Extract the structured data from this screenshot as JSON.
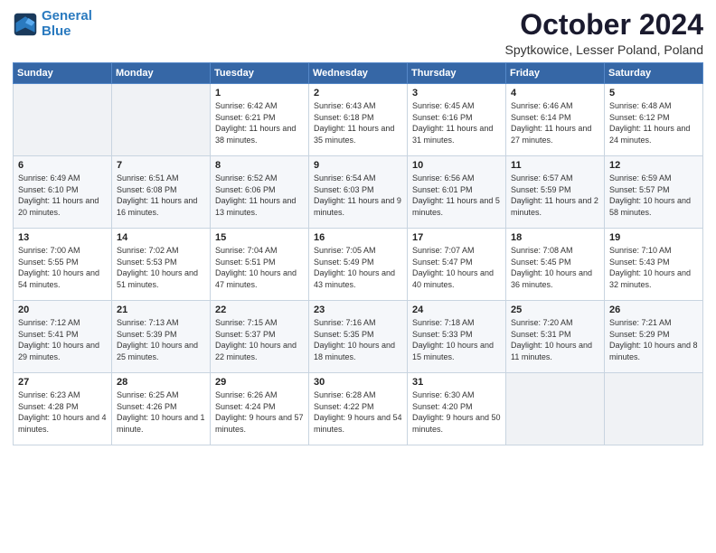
{
  "logo": {
    "line1": "General",
    "line2": "Blue"
  },
  "title": "October 2024",
  "subtitle": "Spytkowice, Lesser Poland, Poland",
  "headers": [
    "Sunday",
    "Monday",
    "Tuesday",
    "Wednesday",
    "Thursday",
    "Friday",
    "Saturday"
  ],
  "weeks": [
    [
      {
        "day": "",
        "sunrise": "",
        "sunset": "",
        "daylight": "",
        "empty": true
      },
      {
        "day": "",
        "sunrise": "",
        "sunset": "",
        "daylight": "",
        "empty": true
      },
      {
        "day": "1",
        "sunrise": "Sunrise: 6:42 AM",
        "sunset": "Sunset: 6:21 PM",
        "daylight": "Daylight: 11 hours and 38 minutes.",
        "empty": false
      },
      {
        "day": "2",
        "sunrise": "Sunrise: 6:43 AM",
        "sunset": "Sunset: 6:18 PM",
        "daylight": "Daylight: 11 hours and 35 minutes.",
        "empty": false
      },
      {
        "day": "3",
        "sunrise": "Sunrise: 6:45 AM",
        "sunset": "Sunset: 6:16 PM",
        "daylight": "Daylight: 11 hours and 31 minutes.",
        "empty": false
      },
      {
        "day": "4",
        "sunrise": "Sunrise: 6:46 AM",
        "sunset": "Sunset: 6:14 PM",
        "daylight": "Daylight: 11 hours and 27 minutes.",
        "empty": false
      },
      {
        "day": "5",
        "sunrise": "Sunrise: 6:48 AM",
        "sunset": "Sunset: 6:12 PM",
        "daylight": "Daylight: 11 hours and 24 minutes.",
        "empty": false
      }
    ],
    [
      {
        "day": "6",
        "sunrise": "Sunrise: 6:49 AM",
        "sunset": "Sunset: 6:10 PM",
        "daylight": "Daylight: 11 hours and 20 minutes.",
        "empty": false
      },
      {
        "day": "7",
        "sunrise": "Sunrise: 6:51 AM",
        "sunset": "Sunset: 6:08 PM",
        "daylight": "Daylight: 11 hours and 16 minutes.",
        "empty": false
      },
      {
        "day": "8",
        "sunrise": "Sunrise: 6:52 AM",
        "sunset": "Sunset: 6:06 PM",
        "daylight": "Daylight: 11 hours and 13 minutes.",
        "empty": false
      },
      {
        "day": "9",
        "sunrise": "Sunrise: 6:54 AM",
        "sunset": "Sunset: 6:03 PM",
        "daylight": "Daylight: 11 hours and 9 minutes.",
        "empty": false
      },
      {
        "day": "10",
        "sunrise": "Sunrise: 6:56 AM",
        "sunset": "Sunset: 6:01 PM",
        "daylight": "Daylight: 11 hours and 5 minutes.",
        "empty": false
      },
      {
        "day": "11",
        "sunrise": "Sunrise: 6:57 AM",
        "sunset": "Sunset: 5:59 PM",
        "daylight": "Daylight: 11 hours and 2 minutes.",
        "empty": false
      },
      {
        "day": "12",
        "sunrise": "Sunrise: 6:59 AM",
        "sunset": "Sunset: 5:57 PM",
        "daylight": "Daylight: 10 hours and 58 minutes.",
        "empty": false
      }
    ],
    [
      {
        "day": "13",
        "sunrise": "Sunrise: 7:00 AM",
        "sunset": "Sunset: 5:55 PM",
        "daylight": "Daylight: 10 hours and 54 minutes.",
        "empty": false
      },
      {
        "day": "14",
        "sunrise": "Sunrise: 7:02 AM",
        "sunset": "Sunset: 5:53 PM",
        "daylight": "Daylight: 10 hours and 51 minutes.",
        "empty": false
      },
      {
        "day": "15",
        "sunrise": "Sunrise: 7:04 AM",
        "sunset": "Sunset: 5:51 PM",
        "daylight": "Daylight: 10 hours and 47 minutes.",
        "empty": false
      },
      {
        "day": "16",
        "sunrise": "Sunrise: 7:05 AM",
        "sunset": "Sunset: 5:49 PM",
        "daylight": "Daylight: 10 hours and 43 minutes.",
        "empty": false
      },
      {
        "day": "17",
        "sunrise": "Sunrise: 7:07 AM",
        "sunset": "Sunset: 5:47 PM",
        "daylight": "Daylight: 10 hours and 40 minutes.",
        "empty": false
      },
      {
        "day": "18",
        "sunrise": "Sunrise: 7:08 AM",
        "sunset": "Sunset: 5:45 PM",
        "daylight": "Daylight: 10 hours and 36 minutes.",
        "empty": false
      },
      {
        "day": "19",
        "sunrise": "Sunrise: 7:10 AM",
        "sunset": "Sunset: 5:43 PM",
        "daylight": "Daylight: 10 hours and 32 minutes.",
        "empty": false
      }
    ],
    [
      {
        "day": "20",
        "sunrise": "Sunrise: 7:12 AM",
        "sunset": "Sunset: 5:41 PM",
        "daylight": "Daylight: 10 hours and 29 minutes.",
        "empty": false
      },
      {
        "day": "21",
        "sunrise": "Sunrise: 7:13 AM",
        "sunset": "Sunset: 5:39 PM",
        "daylight": "Daylight: 10 hours and 25 minutes.",
        "empty": false
      },
      {
        "day": "22",
        "sunrise": "Sunrise: 7:15 AM",
        "sunset": "Sunset: 5:37 PM",
        "daylight": "Daylight: 10 hours and 22 minutes.",
        "empty": false
      },
      {
        "day": "23",
        "sunrise": "Sunrise: 7:16 AM",
        "sunset": "Sunset: 5:35 PM",
        "daylight": "Daylight: 10 hours and 18 minutes.",
        "empty": false
      },
      {
        "day": "24",
        "sunrise": "Sunrise: 7:18 AM",
        "sunset": "Sunset: 5:33 PM",
        "daylight": "Daylight: 10 hours and 15 minutes.",
        "empty": false
      },
      {
        "day": "25",
        "sunrise": "Sunrise: 7:20 AM",
        "sunset": "Sunset: 5:31 PM",
        "daylight": "Daylight: 10 hours and 11 minutes.",
        "empty": false
      },
      {
        "day": "26",
        "sunrise": "Sunrise: 7:21 AM",
        "sunset": "Sunset: 5:29 PM",
        "daylight": "Daylight: 10 hours and 8 minutes.",
        "empty": false
      }
    ],
    [
      {
        "day": "27",
        "sunrise": "Sunrise: 6:23 AM",
        "sunset": "Sunset: 4:28 PM",
        "daylight": "Daylight: 10 hours and 4 minutes.",
        "empty": false
      },
      {
        "day": "28",
        "sunrise": "Sunrise: 6:25 AM",
        "sunset": "Sunset: 4:26 PM",
        "daylight": "Daylight: 10 hours and 1 minute.",
        "empty": false
      },
      {
        "day": "29",
        "sunrise": "Sunrise: 6:26 AM",
        "sunset": "Sunset: 4:24 PM",
        "daylight": "Daylight: 9 hours and 57 minutes.",
        "empty": false
      },
      {
        "day": "30",
        "sunrise": "Sunrise: 6:28 AM",
        "sunset": "Sunset: 4:22 PM",
        "daylight": "Daylight: 9 hours and 54 minutes.",
        "empty": false
      },
      {
        "day": "31",
        "sunrise": "Sunrise: 6:30 AM",
        "sunset": "Sunset: 4:20 PM",
        "daylight": "Daylight: 9 hours and 50 minutes.",
        "empty": false
      },
      {
        "day": "",
        "sunrise": "",
        "sunset": "",
        "daylight": "",
        "empty": true
      },
      {
        "day": "",
        "sunrise": "",
        "sunset": "",
        "daylight": "",
        "empty": true
      }
    ]
  ]
}
